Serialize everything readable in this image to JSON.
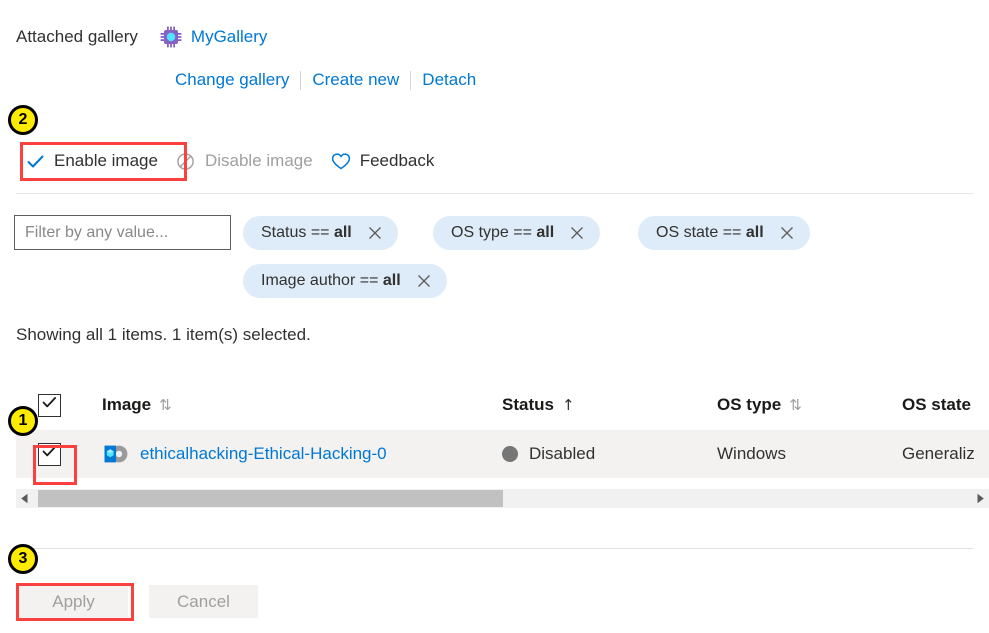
{
  "attached_gallery": {
    "label": "Attached gallery",
    "gallery_icon": "gallery-chip-icon",
    "gallery_name": "MyGallery",
    "links": [
      {
        "label": "Change gallery"
      },
      {
        "label": "Create new"
      },
      {
        "label": "Detach"
      }
    ]
  },
  "command_bar": {
    "items": [
      {
        "label": "Enable image",
        "icon": "checkmark-icon",
        "disabled": false
      },
      {
        "label": "Disable image",
        "icon": "block-icon",
        "disabled": true
      },
      {
        "label": "Feedback",
        "icon": "heart-icon",
        "disabled": false
      }
    ]
  },
  "filter": {
    "input_placeholder": "Filter by any value...",
    "input_value": "",
    "pills": [
      {
        "field": "Status",
        "operator": "==",
        "value": "all"
      },
      {
        "field": "OS type",
        "operator": "==",
        "value": "all"
      },
      {
        "field": "OS state",
        "operator": "==",
        "value": "all"
      },
      {
        "field": "Image author",
        "operator": "==",
        "value": "all"
      }
    ]
  },
  "summary": {
    "text": "Showing all 1 items.  1 item(s) selected."
  },
  "grid": {
    "header": {
      "select_all_checked": true,
      "columns": [
        {
          "label": "Image",
          "sort": "unsorted"
        },
        {
          "label": "Status",
          "sort": "ascending"
        },
        {
          "label": "OS type",
          "sort": "unsorted"
        },
        {
          "label": "OS state",
          "sort": "none"
        }
      ]
    },
    "sort_glyphs": {
      "unsorted": "⇅",
      "ascending": "↑"
    },
    "rows": [
      {
        "checked": true,
        "icon": "azure-image-icon",
        "name": "ethicalhacking-Ethical-Hacking-0",
        "status": "Disabled",
        "status_color": "#767676",
        "os_type": "Windows",
        "os_state": "Generaliz"
      }
    ]
  },
  "scrollbar": {
    "left_arrow": "◀",
    "right_arrow": "▶"
  },
  "footer": {
    "apply_label": "Apply",
    "cancel_label": "Cancel"
  },
  "annotations": {
    "badges": [
      {
        "number": "1"
      },
      {
        "number": "2"
      },
      {
        "number": "3"
      }
    ],
    "highlight_color": "#fb4040",
    "badge_color": "#ffeb00"
  }
}
